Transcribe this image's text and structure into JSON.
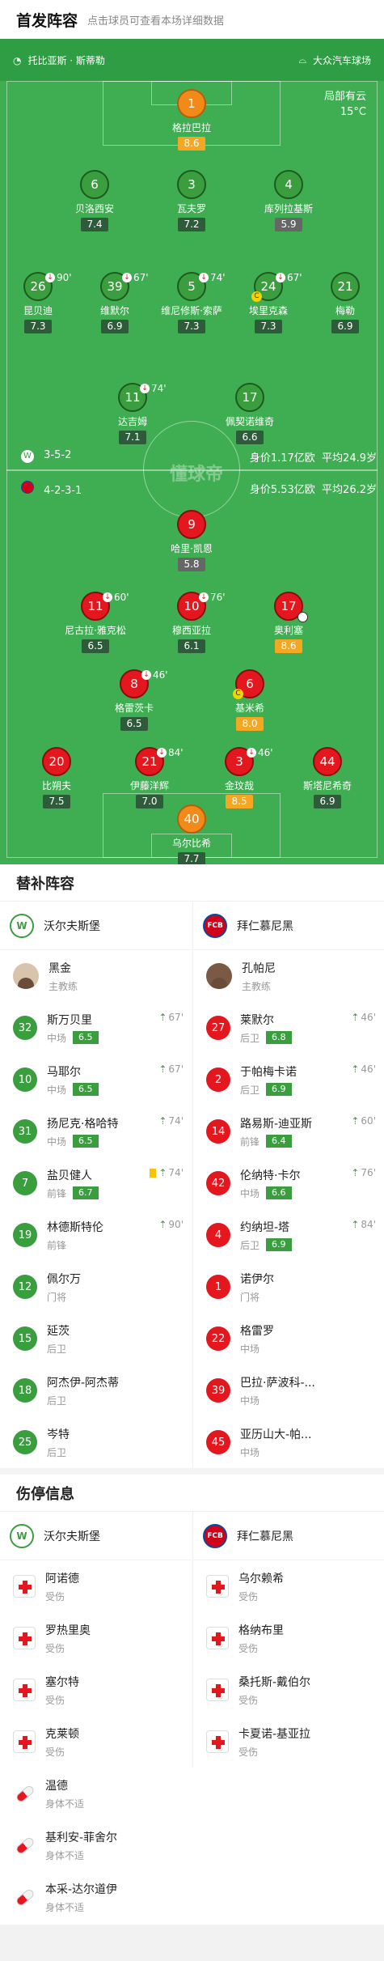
{
  "header": {
    "title": "首发阵容",
    "hint": "点击球员可查看本场详细数据"
  },
  "pitch": {
    "referee_label": "托比亚斯 · 斯蒂勒",
    "stadium": "大众汽车球场",
    "weather": "局部有云",
    "temperature": "15°C",
    "watermark": "懂球帝",
    "home_meta": {
      "formation": "3-5-2",
      "value": "身价1.17亿欧",
      "age": "平均24.9岁"
    },
    "away_meta": {
      "formation": "4-2-3-1",
      "value": "身价5.53亿欧",
      "age": "平均26.2岁"
    },
    "home": [
      {
        "no": "1",
        "name": "格拉巴拉",
        "rating": "8.6",
        "gk": true,
        "hi": true
      },
      {
        "no": "6",
        "name": "贝洛西安",
        "rating": "7.4"
      },
      {
        "no": "3",
        "name": "瓦夫罗",
        "rating": "7.2"
      },
      {
        "no": "4",
        "name": "库列拉基斯",
        "rating": "5.9",
        "lo": true
      },
      {
        "no": "26",
        "name": "昆贝迪",
        "rating": "7.3",
        "sub": "90'"
      },
      {
        "no": "39",
        "name": "维默尔",
        "rating": "6.9",
        "sub": "67'"
      },
      {
        "no": "5",
        "name": "维尼修斯·索萨",
        "rating": "7.3",
        "sub": "74'"
      },
      {
        "no": "24",
        "name": "埃里克森",
        "rating": "7.3",
        "sub": "67'",
        "captain": true
      },
      {
        "no": "21",
        "name": "梅勒",
        "rating": "6.9"
      },
      {
        "no": "11",
        "name": "达吉姆",
        "rating": "7.1",
        "sub": "74'"
      },
      {
        "no": "17",
        "name": "佩契诺维奇",
        "rating": "6.6"
      }
    ],
    "away": [
      {
        "no": "9",
        "name": "哈里·凯恩",
        "rating": "5.8",
        "lo": true
      },
      {
        "no": "11",
        "name": "尼古拉·雅克松",
        "rating": "6.5",
        "sub": "60'"
      },
      {
        "no": "10",
        "name": "穆西亚拉",
        "rating": "6.1",
        "sub": "76'"
      },
      {
        "no": "17",
        "name": "奥利塞",
        "rating": "8.6",
        "hi": true,
        "goal": true
      },
      {
        "no": "8",
        "name": "格雷茨卡",
        "rating": "6.5",
        "sub": "46'"
      },
      {
        "no": "6",
        "name": "基米希",
        "rating": "8.0",
        "hi": true,
        "captain": true
      },
      {
        "no": "20",
        "name": "比朔夫",
        "rating": "7.5"
      },
      {
        "no": "21",
        "name": "伊藤洋辉",
        "rating": "7.0",
        "sub": "84'"
      },
      {
        "no": "3",
        "name": "金玟哉",
        "rating": "8.5",
        "sub": "46'",
        "hi": true
      },
      {
        "no": "44",
        "name": "斯塔尼希奇",
        "rating": "6.9"
      },
      {
        "no": "40",
        "name": "乌尔比希",
        "rating": "7.7",
        "gk": true
      }
    ]
  },
  "subs": {
    "title": "替补阵容",
    "home_team": "沃尔夫斯堡",
    "away_team": "拜仁慕尼黑",
    "home_coach": {
      "name": "黑金",
      "role": "主教练"
    },
    "away_coach": {
      "name": "孔帕尼",
      "role": "主教练"
    },
    "home": [
      {
        "no": "32",
        "name": "斯万贝里",
        "pos": "中场",
        "rating": "6.5",
        "time": "67'"
      },
      {
        "no": "10",
        "name": "马耶尔",
        "pos": "中场",
        "rating": "6.5",
        "time": "67'"
      },
      {
        "no": "31",
        "name": "扬尼克·格哈特",
        "pos": "中场",
        "rating": "6.5",
        "time": "74'"
      },
      {
        "no": "7",
        "name": "盐贝健人",
        "pos": "前锋",
        "rating": "6.7",
        "time": "74'",
        "yellow": true
      },
      {
        "no": "19",
        "name": "林德斯特伦",
        "pos": "前锋",
        "time": "90'"
      },
      {
        "no": "12",
        "name": "佩尔万",
        "pos": "门将"
      },
      {
        "no": "15",
        "name": "延茨",
        "pos": "后卫"
      },
      {
        "no": "18",
        "name": "阿杰伊-阿杰蒂",
        "pos": "后卫"
      },
      {
        "no": "25",
        "name": "岑特",
        "pos": "后卫"
      }
    ],
    "away": [
      {
        "no": "27",
        "name": "莱默尔",
        "pos": "后卫",
        "rating": "6.8",
        "time": "46'"
      },
      {
        "no": "2",
        "name": "于帕梅卡诺",
        "pos": "后卫",
        "rating": "6.9",
        "time": "46'"
      },
      {
        "no": "14",
        "name": "路易斯-迪亚斯",
        "pos": "前锋",
        "rating": "6.4",
        "time": "60'"
      },
      {
        "no": "42",
        "name": "伦纳特·卡尔",
        "pos": "中场",
        "rating": "6.6",
        "time": "76'"
      },
      {
        "no": "4",
        "name": "约纳坦-塔",
        "pos": "后卫",
        "rating": "6.9",
        "time": "84'"
      },
      {
        "no": "1",
        "name": "诺伊尔",
        "pos": "门将"
      },
      {
        "no": "22",
        "name": "格雷罗",
        "pos": "中场"
      },
      {
        "no": "39",
        "name": "巴拉·萨波科-...",
        "pos": "中场"
      },
      {
        "no": "45",
        "name": "亚历山大-帕...",
        "pos": "中场"
      }
    ]
  },
  "injuries": {
    "title": "伤停信息",
    "home_team": "沃尔夫斯堡",
    "away_team": "拜仁慕尼黑",
    "home": [
      {
        "name": "阿诺德",
        "status": "受伤",
        "icon": "injury-icon"
      },
      {
        "name": "罗热里奥",
        "status": "受伤",
        "icon": "injury-icon"
      },
      {
        "name": "塞尔特",
        "status": "受伤",
        "icon": "injury-icon"
      },
      {
        "name": "克莱顿",
        "status": "受伤",
        "icon": "injury-icon"
      },
      {
        "name": "温德",
        "status": "身体不适",
        "icon": "illness-icon"
      },
      {
        "name": "基利安-菲舍尔",
        "status": "身体不适",
        "icon": "illness-icon"
      },
      {
        "name": "本采-达尔道伊",
        "status": "身体不适",
        "icon": "illness-icon"
      }
    ],
    "away": [
      {
        "name": "乌尔赖希",
        "status": "受伤",
        "icon": "injury-icon"
      },
      {
        "name": "格纳布里",
        "status": "受伤",
        "icon": "injury-icon"
      },
      {
        "name": "桑托斯-戴伯尔",
        "status": "受伤",
        "icon": "injury-icon"
      },
      {
        "name": "卡夏诺-基亚拉",
        "status": "受伤",
        "icon": "injury-icon"
      }
    ]
  }
}
